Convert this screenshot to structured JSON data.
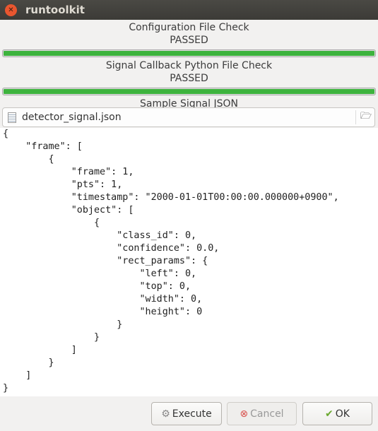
{
  "window": {
    "title": "runtoolkit"
  },
  "checks": [
    {
      "label": "Configuration File Check",
      "status": "PASSED",
      "progress": 100
    },
    {
      "label": "Signal Callback Python File Check",
      "status": "PASSED",
      "progress": 100
    }
  ],
  "sample": {
    "label": "Sample Signal JSON",
    "file": "detector_signal.json",
    "content": "{\n    \"frame\": [\n        {\n            \"frame\": 1,\n            \"pts\": 1,\n            \"timestamp\": \"2000-01-01T00:00:00.000000+0900\",\n            \"object\": [\n                {\n                    \"class_id\": 0,\n                    \"confidence\": 0.0,\n                    \"rect_params\": {\n                        \"left\": 0,\n                        \"top\": 0,\n                        \"width\": 0,\n                        \"height\": 0\n                    }\n                }\n            ]\n        }\n    ]\n}"
  },
  "buttons": {
    "execute": "Execute",
    "cancel": "Cancel",
    "ok": "OK"
  }
}
